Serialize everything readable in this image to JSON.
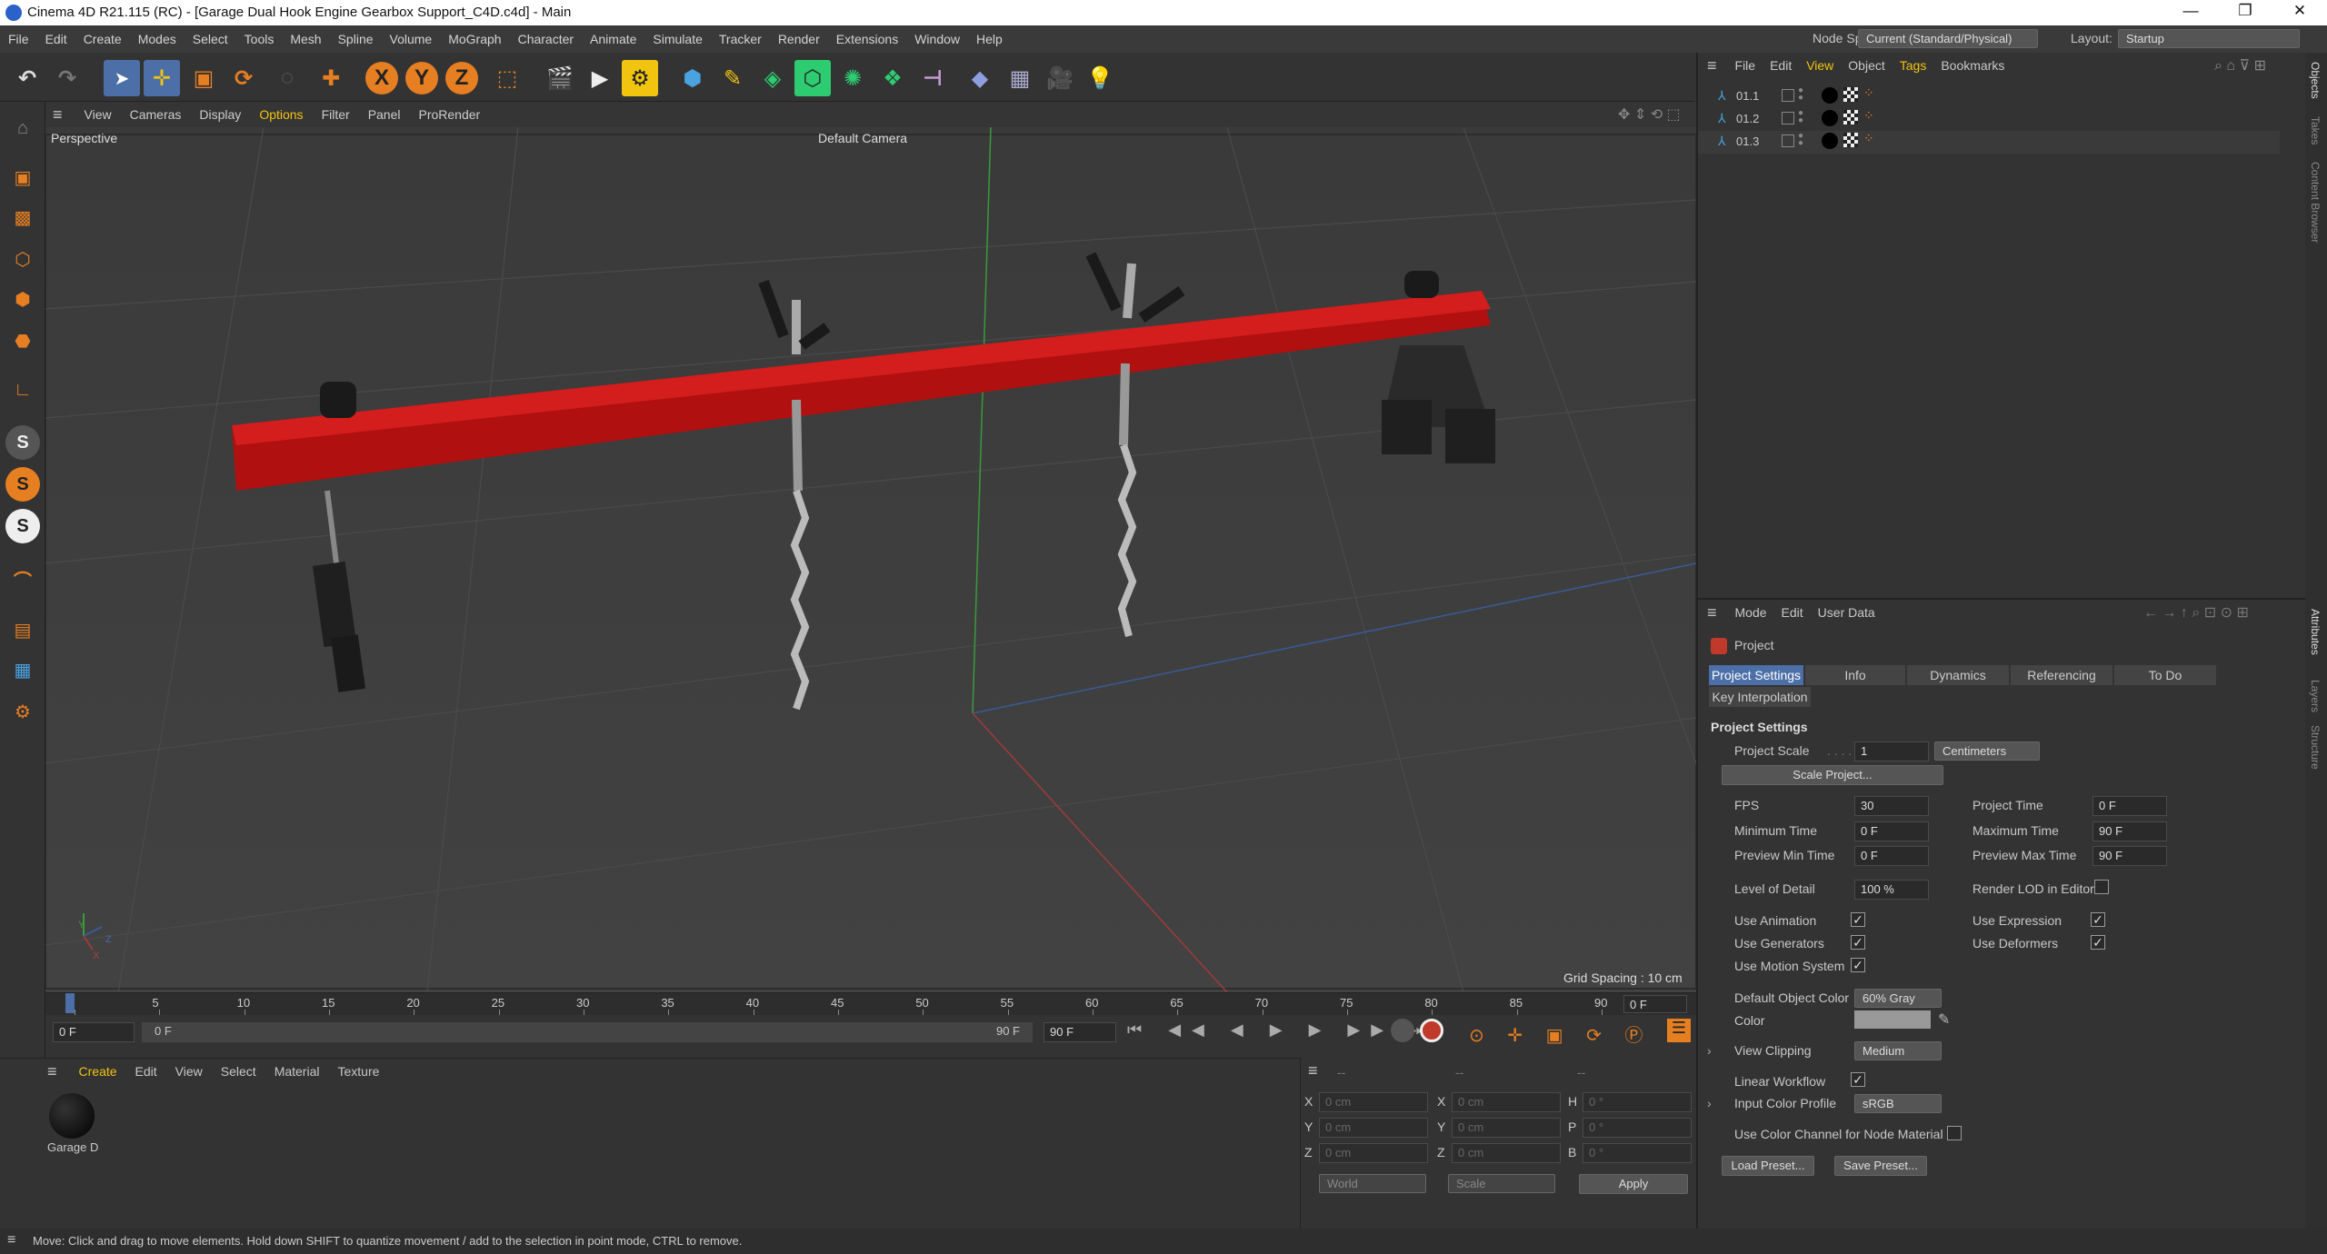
{
  "window": {
    "title": "Cinema 4D R21.115 (RC) - [Garage Dual Hook Engine Gearbox Support_C4D.c4d] - Main",
    "minimize": "—",
    "maximize": "❐",
    "close": "✕"
  },
  "menu": [
    "File",
    "Edit",
    "Create",
    "Modes",
    "Select",
    "Tools",
    "Mesh",
    "Spline",
    "Volume",
    "MoGraph",
    "Character",
    "Animate",
    "Simulate",
    "Tracker",
    "Render",
    "Extensions",
    "Window",
    "Help"
  ],
  "node_space": {
    "label": "Node Space:",
    "value": "Current (Standard/Physical)",
    "layout_label": "Layout:",
    "layout_value": "Startup"
  },
  "viewport": {
    "menu": [
      "View",
      "Cameras",
      "Display",
      "Options",
      "Filter",
      "Panel",
      "ProRender"
    ],
    "name": "Perspective",
    "camera": "Default Camera",
    "grid_spacing": "Grid Spacing : 10 cm",
    "axis_y": "Y",
    "axis_z": "Z",
    "axis_x": "X"
  },
  "timeline": {
    "ticks": [
      "0",
      "5",
      "10",
      "15",
      "20",
      "25",
      "30",
      "35",
      "40",
      "45",
      "50",
      "55",
      "60",
      "65",
      "70",
      "75",
      "80",
      "85",
      "90"
    ],
    "current": "0 F",
    "start": "0 F",
    "range_start": "0 F",
    "range_end": "90 F",
    "end": "90 F",
    "end_field": "0 F"
  },
  "materials": {
    "menu": [
      "Create",
      "Edit",
      "View",
      "Select",
      "Material",
      "Texture"
    ],
    "items": [
      {
        "name": "Garage D"
      }
    ]
  },
  "coords": {
    "rows": [
      {
        "a": "X",
        "av": "0 cm",
        "b": "X",
        "bv": "0 cm",
        "c": "H",
        "cv": "0 °"
      },
      {
        "a": "Y",
        "av": "0 cm",
        "b": "Y",
        "bv": "0 cm",
        "c": "P",
        "cv": "0 °"
      },
      {
        "a": "Z",
        "av": "0 cm",
        "b": "Z",
        "bv": "0 cm",
        "c": "B",
        "cv": "0 °"
      }
    ],
    "world": "World",
    "scale": "Scale",
    "apply": "Apply",
    "top_a": "--",
    "top_b": "--",
    "top_c": "--"
  },
  "objects": {
    "menu": [
      "File",
      "Edit",
      "View",
      "Object",
      "Tags",
      "Bookmarks"
    ],
    "items": [
      {
        "name": "01.1"
      },
      {
        "name": "01.2"
      },
      {
        "name": "01.3"
      }
    ]
  },
  "attributes": {
    "menu": [
      "Mode",
      "Edit",
      "User Data"
    ],
    "object": "Project",
    "tabs": [
      "Project Settings",
      "Info",
      "Dynamics",
      "Referencing",
      "To Do"
    ],
    "tab2": "Key Interpolation",
    "section": "Project Settings",
    "project_scale_label": "Project Scale",
    "project_scale": "1",
    "unit": "Centimeters",
    "scale_project": "Scale Project...",
    "fps_label": "FPS",
    "fps": "30",
    "project_time_label": "Project Time",
    "project_time": "0 F",
    "min_time_label": "Minimum Time",
    "min_time": "0 F",
    "max_time_label": "Maximum Time",
    "max_time": "90 F",
    "pmin_label": "Preview Min Time",
    "pmin": "0 F",
    "pmax_label": "Preview Max Time",
    "pmax": "90 F",
    "lod_label": "Level of Detail",
    "lod": "100 %",
    "render_lod_label": "Render LOD in Editor",
    "use_animation": "Use Animation",
    "use_expression": "Use Expression",
    "use_generators": "Use Generators",
    "use_deformers": "Use Deformers",
    "use_motion": "Use Motion System",
    "doc_label": "Default Object Color",
    "doc_value": "60% Gray",
    "color_label": "Color",
    "view_clipping_label": "View Clipping",
    "view_clipping": "Medium",
    "linear_workflow": "Linear Workflow",
    "input_profile_label": "Input Color Profile",
    "input_profile": "sRGB",
    "color_channel": "Use Color Channel for Node Material",
    "load_preset": "Load Preset...",
    "save_preset": "Save Preset...",
    "check": "✓"
  },
  "right_tabs": [
    "Objects",
    "Takes",
    "Content Browser",
    "Attributes",
    "Layers",
    "Structure"
  ],
  "status": "Move: Click and drag to move elements. Hold down SHIFT to quantize movement / add to the selection in point mode, CTRL to remove.",
  "icons": {
    "undo": "↶",
    "redo": "↷",
    "move": "✛",
    "rotate": "⟳",
    "play": "▶",
    "first": "⏮",
    "last": "⏭",
    "prev": "◀",
    "next": "▶",
    "rec": "●",
    "light": "💡"
  },
  "colors": {
    "accent": "#4c6fa8",
    "bar_red": "#b01010",
    "selection": "#f1c40f"
  }
}
